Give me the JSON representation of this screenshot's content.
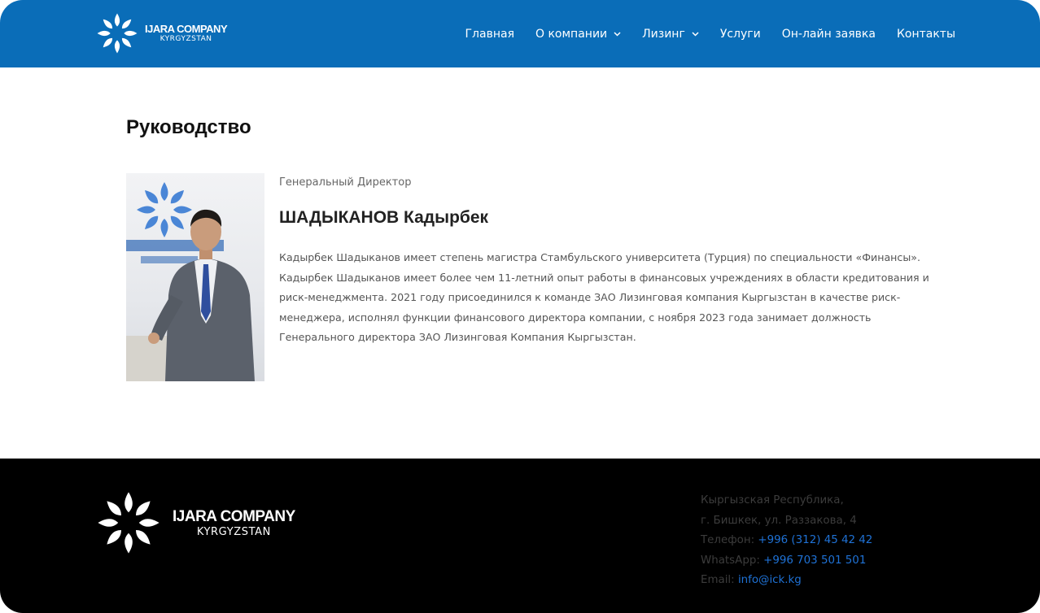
{
  "brand": {
    "name": "IJARA COMPANY",
    "subtitle": "KYRGYZSTAN"
  },
  "nav": {
    "items": [
      {
        "label": "Главная",
        "dropdown": false
      },
      {
        "label": "О компании",
        "dropdown": true
      },
      {
        "label": "Лизинг",
        "dropdown": true
      },
      {
        "label": "Услуги",
        "dropdown": false
      },
      {
        "label": "Он-лайн заявка",
        "dropdown": false
      },
      {
        "label": "Контакты",
        "dropdown": false
      }
    ]
  },
  "page": {
    "title": "Руководство"
  },
  "leader": {
    "role": "Генеральный Директор",
    "name": "ШАДЫКАНОВ Кадырбек",
    "bio": "Кадырбек Шадыканов имеет степень магистра Стамбульского университета (Турция) по специальности «Финансы». Кадырбек Шадыканов имеет более чем 11-летний опыт работы в финансовых учреждениях в области кредитования и риск-менеджмента. 2021 году присоединился к команде ЗАО Лизинговая компания Кыргызстан в качестве риск-менеджера, исполнял функции финансового директора компании, с ноября 2023 года занимает должность Генерального директора ЗАО Лизинговая Компания Кыргызстан."
  },
  "footer": {
    "address_line1": "Кыргызская Республика,",
    "address_line2": "г. Бишкек, ул. Раззакова, 4",
    "phone_label": "Телефон:",
    "phone": "+996 (312) 45 42 42",
    "whatsapp_label": "WhatsApp:",
    "whatsapp": "+996 703 501 501",
    "email_label": "Email:",
    "email": "info@ick.kg"
  },
  "colors": {
    "header": "#0a6db8",
    "footer": "#000000",
    "link": "#1f72d6"
  },
  "icons": {
    "logo": "star-flower-logo-icon",
    "dropdown": "chevron-down-icon"
  }
}
